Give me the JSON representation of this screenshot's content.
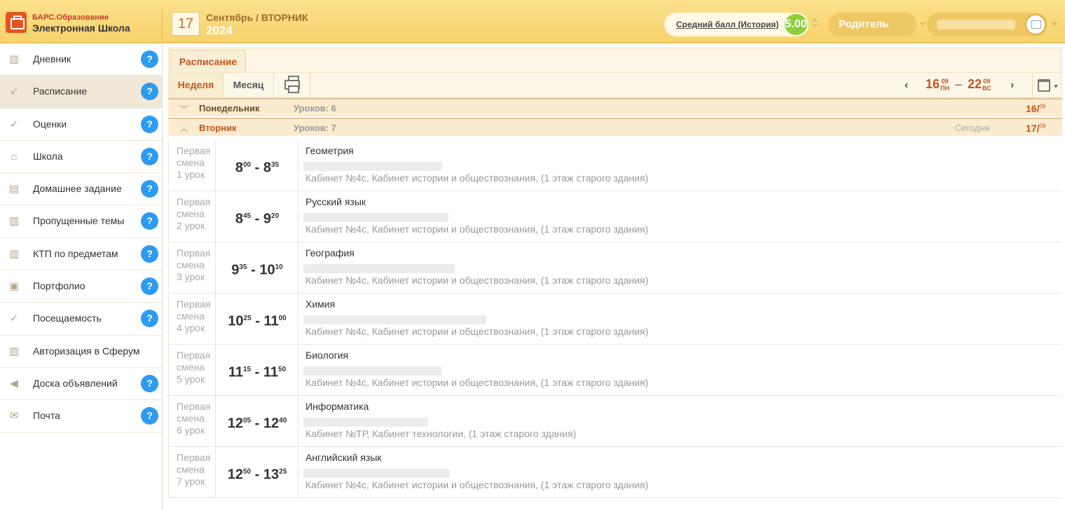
{
  "header": {
    "brand_top": "БАРС.Образование",
    "brand_bottom": "Электронная Школа",
    "day": "17",
    "month_weekday": "Сентябрь / ВТОРНИК",
    "year": "2024",
    "average_label": "Средний балл (История)",
    "average_value": "5.00",
    "role": "Родитель",
    "colors": {
      "accent": "#c2551f",
      "header_bg": "#f8d36e",
      "help": "#2e9bf0",
      "score": "#8ecf3c"
    }
  },
  "sidebar": {
    "items": [
      {
        "label": "Дневник",
        "icon": "book-icon",
        "glyph": "▥",
        "help": "?"
      },
      {
        "label": "Расписание",
        "icon": "paper-plane-icon",
        "glyph": "➶",
        "help": "?"
      },
      {
        "label": "Оценки",
        "icon": "check-icon",
        "glyph": "✓",
        "help": "?"
      },
      {
        "label": "Школа",
        "icon": "building-icon",
        "glyph": "⌂",
        "help": "?"
      },
      {
        "label": "Домашнее задание",
        "icon": "board-icon",
        "glyph": "▤",
        "help": "?"
      },
      {
        "label": "Пропущенные темы",
        "icon": "book-icon",
        "glyph": "▥",
        "help": "?"
      },
      {
        "label": "КТП по предметам",
        "icon": "book-icon",
        "glyph": "▥",
        "help": "?"
      },
      {
        "label": "Портфолио",
        "icon": "briefcase-icon",
        "glyph": "▣",
        "help": "?"
      },
      {
        "label": "Посещаемость",
        "icon": "check-icon",
        "glyph": "✓",
        "help": "?"
      },
      {
        "label": "Авторизация в Сферум",
        "icon": "book-icon",
        "glyph": "▥",
        "help": ""
      },
      {
        "label": "Доска объявлений",
        "icon": "megaphone-icon",
        "glyph": "◀",
        "help": "?"
      },
      {
        "label": "Почта",
        "icon": "mail-icon",
        "glyph": "✉",
        "help": "?"
      }
    ]
  },
  "schedule": {
    "tab": "Расписание",
    "view_week": "Неделя",
    "view_month": "Месяц",
    "range": {
      "start_day": "16",
      "start_month": "09",
      "start_wd": "ПН",
      "end_day": "22",
      "end_month": "09",
      "end_wd": "ВС",
      "dash": "–"
    },
    "nav_prev": "‹",
    "nav_next": "›",
    "days": [
      {
        "name": "Понедельник",
        "count": "Уроков: 6",
        "today": "",
        "date": "16/",
        "date_sup": "09",
        "expanded": false
      },
      {
        "name": "Вторник",
        "count": "Уроков: 7",
        "today": "Сегодня",
        "date": "17/",
        "date_sup": "09",
        "expanded": true
      }
    ],
    "lessons": [
      {
        "shift": "Первая",
        "shift2": "смена",
        "num": "1 урок",
        "start_h": "8",
        "start_m": "00",
        "end_h": "8",
        "end_m": "35",
        "subject": "Геометрия",
        "room": "Кабинет №4с, Кабинет истории и обществознания, (1 этаж старого здания)"
      },
      {
        "shift": "Первая",
        "shift2": "смена",
        "num": "2 урок",
        "start_h": "8",
        "start_m": "45",
        "end_h": "9",
        "end_m": "20",
        "subject": "Русский язык",
        "room": "Кабинет №4с, Кабинет истории и обществознания, (1 этаж старого здания)"
      },
      {
        "shift": "Первая",
        "shift2": "смена",
        "num": "3 урок",
        "start_h": "9",
        "start_m": "35",
        "end_h": "10",
        "end_m": "10",
        "subject": "География",
        "room": "Кабинет №4с, Кабинет истории и обществознания, (1 этаж старого здания)"
      },
      {
        "shift": "Первая",
        "shift2": "смена",
        "num": "4 урок",
        "start_h": "10",
        "start_m": "25",
        "end_h": "11",
        "end_m": "00",
        "subject": "Химия",
        "room": "Кабинет №4с, Кабинет истории и обществознания, (1 этаж старого здания)"
      },
      {
        "shift": "Первая",
        "shift2": "смена",
        "num": "5 урок",
        "start_h": "11",
        "start_m": "15",
        "end_h": "11",
        "end_m": "50",
        "subject": "Биология",
        "room": "Кабинет №4с, Кабинет истории и обществознания, (1 этаж старого здания)"
      },
      {
        "shift": "Первая",
        "shift2": "смена",
        "num": "6 урок",
        "start_h": "12",
        "start_m": "05",
        "end_h": "12",
        "end_m": "40",
        "subject": "Информатика",
        "room": "Кабинет №ТР, Кабинет технологии, (1 этаж старого здания)"
      },
      {
        "shift": "Первая",
        "shift2": "смена",
        "num": "7 урок",
        "start_h": "12",
        "start_m": "50",
        "end_h": "13",
        "end_m": "25",
        "subject": "Английский язык",
        "room": "Кабинет №4с, Кабинет истории и обществознания, (1 этаж старого здания)"
      }
    ]
  }
}
